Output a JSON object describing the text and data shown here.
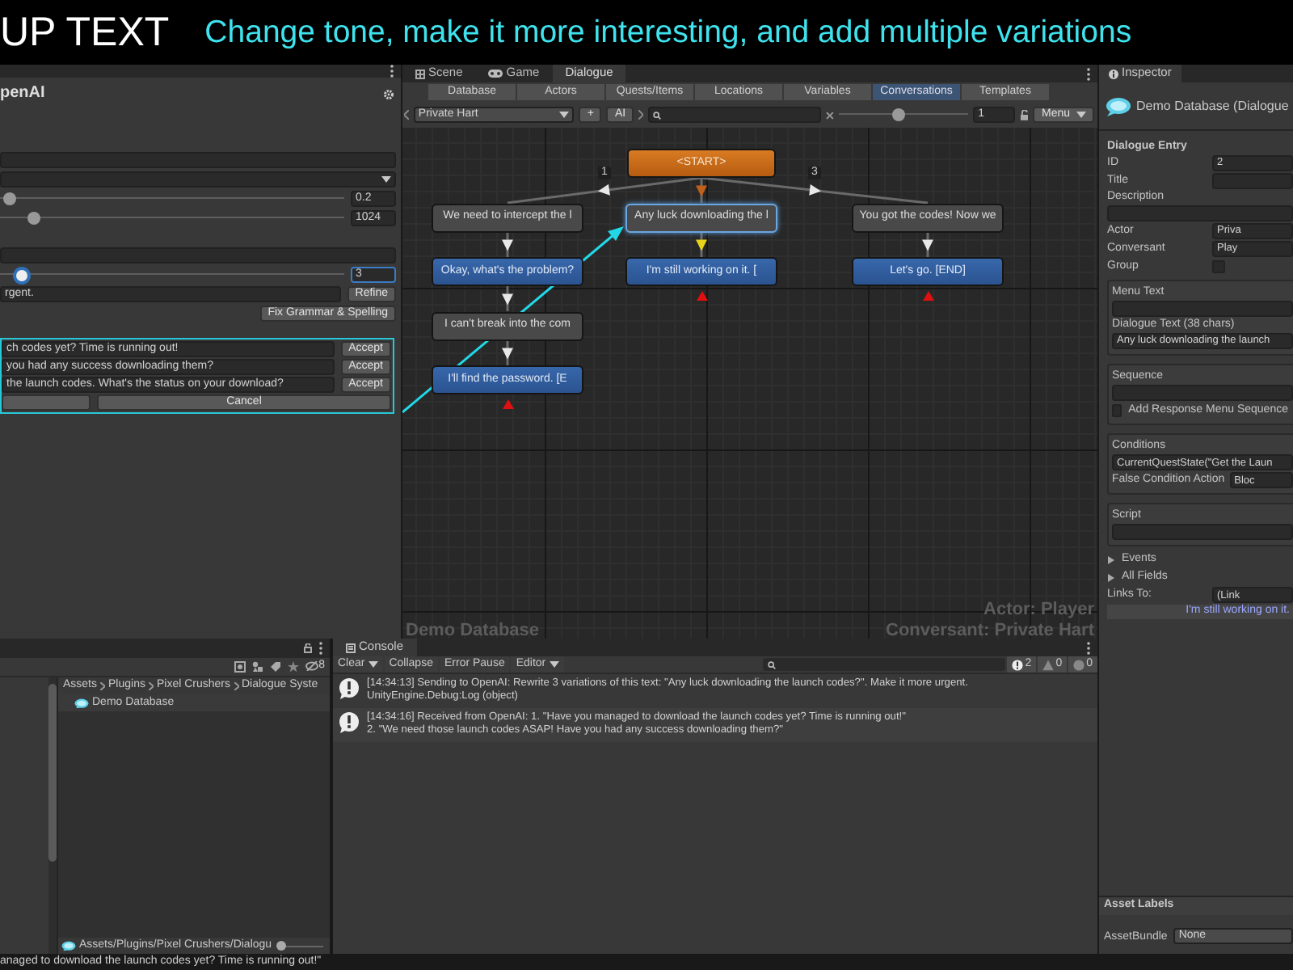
{
  "banner": {
    "title": "UP TEXT",
    "subtitle": "Change tone, make it more interesting, and add multiple variations"
  },
  "openai_panel": {
    "title": "penAI",
    "sliders": [
      {
        "level": 0.03,
        "reading": "0.2"
      },
      {
        "level": 0.1,
        "reading": "1024"
      }
    ],
    "variation_slider": {
      "level": 0.06,
      "reading": "3"
    },
    "prompt": {
      "value": "rgent."
    },
    "refine_button": "Refine",
    "fix_button": "Fix Grammar & Spelling",
    "variations": [
      {
        "text": "ch codes yet? Time is running out!",
        "button": "Accept"
      },
      {
        "text": "you had any success downloading them?",
        "button": "Accept"
      },
      {
        "text": "the launch codes. What's the status on your download?",
        "button": "Accept"
      }
    ],
    "cancel_button": "Cancel"
  },
  "dialogue_editor": {
    "window_tabs": [
      {
        "label": "Scene",
        "selected": false
      },
      {
        "label": "Game",
        "selected": false
      },
      {
        "label": "Dialogue",
        "selected": true
      }
    ],
    "section_tabs": [
      {
        "label": "Database",
        "selected": false
      },
      {
        "label": "Actors",
        "selected": false
      },
      {
        "label": "Quests/Items",
        "selected": false
      },
      {
        "label": "Locations",
        "selected": false
      },
      {
        "label": "Variables",
        "selected": false
      },
      {
        "label": "Conversations",
        "selected": true
      },
      {
        "label": "Templates",
        "selected": false
      }
    ],
    "conversation_dropdown": "Private Hart",
    "add_button": "+",
    "ai_button": "AI",
    "zoom_slider": {
      "level": 0.46
    },
    "zoom_value": "1",
    "menu_button": "Menu",
    "graph": {
      "kind": "start",
      "text": "<START>",
      "selected": false,
      "children": [
        {
          "kind": "npc",
          "text": "We need to intercept the l",
          "selected": false,
          "link_label": "1",
          "children": [
            {
              "kind": "player",
              "text": "Okay, what's the problem?",
              "selected": false,
              "children": [
                {
                  "kind": "npc",
                  "text": "I can't break into the com",
                  "selected": false,
                  "children": [
                    {
                      "kind": "player",
                      "text": "I'll find the password. [E",
                      "selected": false
                    }
                  ]
                }
              ]
            }
          ]
        },
        {
          "kind": "npc",
          "text": "Any luck downloading the l",
          "selected": true,
          "children": [
            {
              "kind": "player",
              "text": "I'm still working on it. [",
              "selected": false
            }
          ]
        },
        {
          "kind": "npc",
          "text": "You got the codes! Now we",
          "selected": false,
          "link_label": "3",
          "children": [
            {
              "kind": "player",
              "text": "Let's go. [END]",
              "selected": false
            }
          ]
        }
      ]
    },
    "database_label": "Demo Database",
    "actor_label": "Actor: Player",
    "conversant_label": "Conversant: Private Hart"
  },
  "inspector": {
    "tab": "Inspector",
    "header": "Demo Database (Dialogue",
    "section": "Dialogue Entry",
    "fields": [
      {
        "kind": "field",
        "label": "ID",
        "value": "2"
      },
      {
        "kind": "field",
        "label": "Title"
      },
      {
        "kind": "wide",
        "label": "Description"
      },
      {
        "kind": "field",
        "label": "Actor",
        "value": "Priva"
      },
      {
        "kind": "field",
        "label": "Conversant",
        "value": "Play"
      },
      {
        "kind": "checkbox",
        "label": "Group",
        "checked": false
      }
    ],
    "boxes": [
      {
        "fields": [
          {
            "kind": "wide",
            "label": "Menu Text"
          },
          {
            "kind": "wide",
            "label": "Dialogue Text (38 chars)",
            "value": "Any luck downloading the launch"
          }
        ]
      },
      {
        "fields": [
          {
            "kind": "wide",
            "label": "Sequence"
          },
          {
            "kind": "checkbox_wide",
            "label": "Add Response Menu Sequence",
            "checked": false
          }
        ]
      },
      {
        "fields": [
          {
            "kind": "wide",
            "label": "Conditions",
            "value": "CurrentQuestState(\"Get the Laun"
          },
          {
            "kind": "field",
            "label": "False Condition Action",
            "value": "Bloc"
          }
        ]
      },
      {
        "fields": [
          {
            "kind": "wide",
            "label": "Script"
          }
        ]
      }
    ],
    "foldouts": [
      {
        "label": "Events",
        "expanded": false
      },
      {
        "label": "All Fields",
        "expanded": false
      }
    ],
    "links": {
      "label": "Links To:",
      "value": "(Link",
      "items": [
        "I'm still working on it."
      ]
    },
    "asset_labels": "Asset Labels",
    "asset_bundle": {
      "label": "AssetBundle",
      "value": "None"
    }
  },
  "project": {
    "hidden_count": "8",
    "breadcrumb": [
      "Assets",
      "Plugins",
      "Pixel Crushers",
      "Dialogue Syste"
    ],
    "items": [
      "Demo Database"
    ],
    "footer_path": "Assets/Plugins/Pixel Crushers/Dialogu",
    "icon_size_slider": {
      "level": 0
    }
  },
  "console": {
    "tab": "Console",
    "buttons": [
      "Clear",
      "Collapse",
      "Error Pause",
      "Editor"
    ],
    "counts": {
      "info": "2",
      "warning": "0",
      "error": "0"
    },
    "entries": [
      {
        "lines": [
          "[14:34:13] Sending to OpenAI: Rewrite 3 variations of this text: \"Any luck downloading the launch codes?\". Make it more urgent.",
          "UnityEngine.Debug:Log (object)"
        ]
      },
      {
        "lines": [
          "[14:34:16] Received from OpenAI: 1. \"Have you managed to download the launch codes yet? Time is running out!\"",
          "2. \"We need those launch codes ASAP! Have you had any success downloading them?\""
        ]
      }
    ]
  },
  "status_bar": "anaged to download the launch codes yet? Time is running out!\""
}
